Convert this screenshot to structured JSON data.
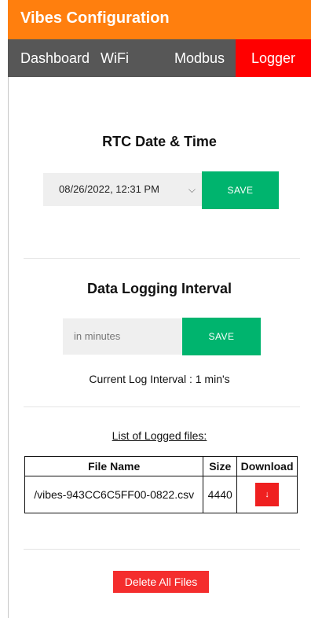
{
  "app": {
    "title": "Vibes Configuration"
  },
  "nav": {
    "tabs": [
      {
        "label": "Dashboard"
      },
      {
        "label": "WiFi"
      },
      {
        "label": "Modbus"
      },
      {
        "label": "Logger",
        "active": true
      }
    ]
  },
  "rtc": {
    "title": "RTC Date & Time",
    "datetime_value": "08/26/2022, 12:31 PM",
    "save_label": "SAVE"
  },
  "logging": {
    "title": "Data Logging Interval",
    "interval_placeholder": "in minutes",
    "save_label": "SAVE",
    "current_interval_text": "Current Log Interval : 1 min's"
  },
  "files": {
    "heading": "List of Logged files:",
    "columns": [
      "File Name",
      "Size",
      "Download"
    ],
    "rows": [
      {
        "name": "/vibes-943CC6C5FF00-0822.csv",
        "size": "4440",
        "download_icon": "↓"
      }
    ],
    "delete_all_label": "Delete All Files"
  },
  "colors": {
    "header": "#ff7f0e",
    "nav": "#575757",
    "active_tab": "#ff0000",
    "save_button": "#00b46e",
    "danger": "#f42d2d"
  }
}
